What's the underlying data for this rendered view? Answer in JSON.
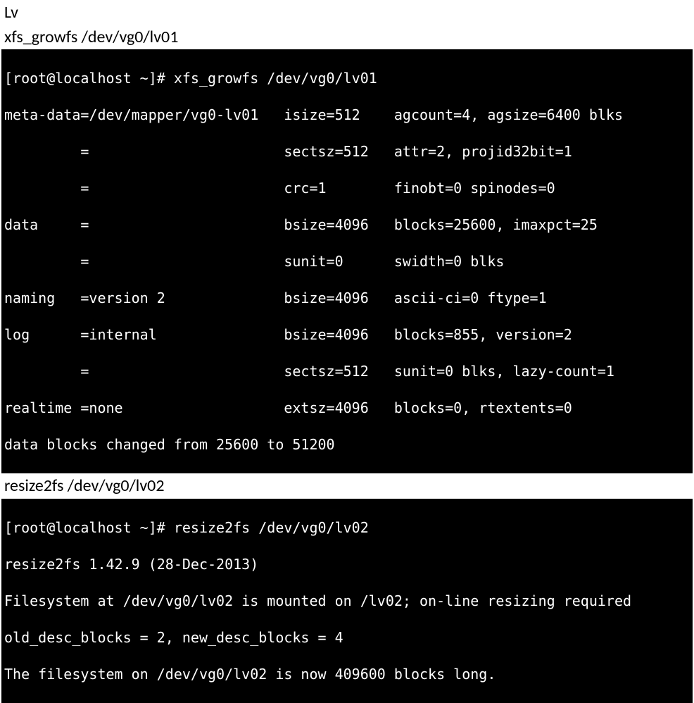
{
  "headings": {
    "lv": "Lv",
    "cmd1": "xfs_growfs /dev/vg0/lv01",
    "cmd2": "resize2fs /dev/vg0/lv02"
  },
  "terminal1": {
    "lines": [
      "[root@localhost ~]# xfs_growfs /dev/vg0/lv01",
      "meta-data=/dev/mapper/vg0-lv01   isize=512    agcount=4, agsize=6400 blks",
      "         =                       sectsz=512   attr=2, projid32bit=1",
      "         =                       crc=1        finobt=0 spinodes=0",
      "data     =                       bsize=4096   blocks=25600, imaxpct=25",
      "         =                       sunit=0      swidth=0 blks",
      "naming   =version 2              bsize=4096   ascii-ci=0 ftype=1",
      "log      =internal               bsize=4096   blocks=855, version=2",
      "         =                       sectsz=512   sunit=0 blks, lazy-count=1",
      "realtime =none                   extsz=4096   blocks=0, rtextents=0",
      "data blocks changed from 25600 to 51200"
    ]
  },
  "terminal2": {
    "lines": [
      "[root@localhost ~]# resize2fs /dev/vg0/lv02",
      "resize2fs 1.42.9 (28-Dec-2013)",
      "Filesystem at /dev/vg0/lv02 is mounted on /lv02; on-line resizing required",
      "old_desc_blocks = 2, new_desc_blocks = 4",
      "The filesystem on /dev/vg0/lv02 is now 409600 blocks long."
    ]
  }
}
